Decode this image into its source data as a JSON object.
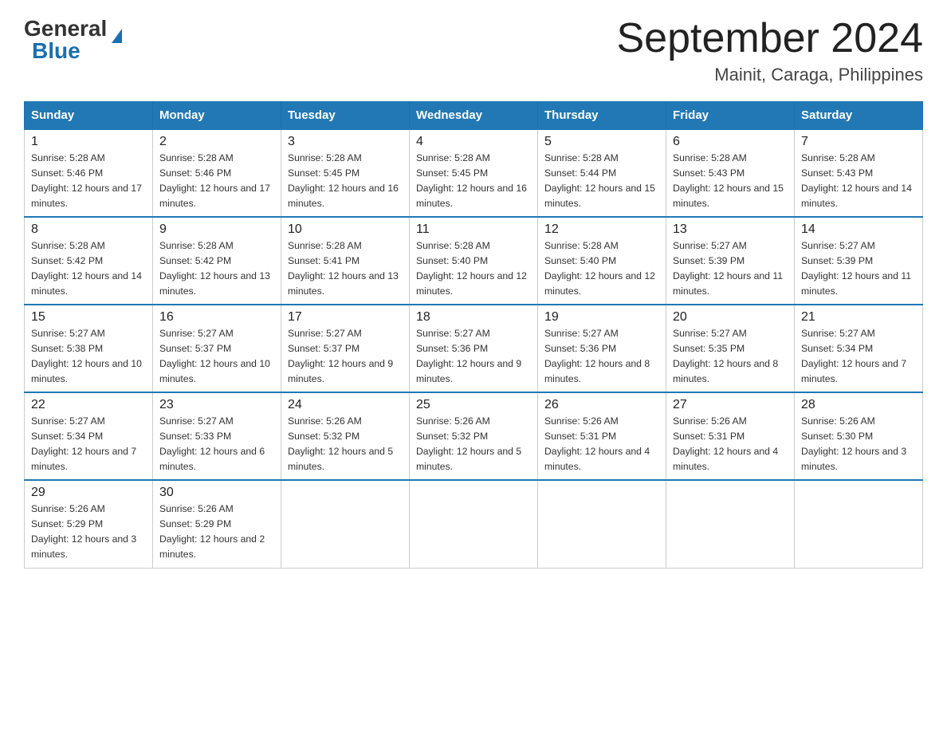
{
  "header": {
    "logo_general": "General",
    "logo_blue": "Blue",
    "month_year": "September 2024",
    "location": "Mainit, Caraga, Philippines"
  },
  "days_of_week": [
    "Sunday",
    "Monday",
    "Tuesday",
    "Wednesday",
    "Thursday",
    "Friday",
    "Saturday"
  ],
  "weeks": [
    [
      {
        "day": "1",
        "sunrise": "5:28 AM",
        "sunset": "5:46 PM",
        "daylight": "12 hours and 17 minutes."
      },
      {
        "day": "2",
        "sunrise": "5:28 AM",
        "sunset": "5:46 PM",
        "daylight": "12 hours and 17 minutes."
      },
      {
        "day": "3",
        "sunrise": "5:28 AM",
        "sunset": "5:45 PM",
        "daylight": "12 hours and 16 minutes."
      },
      {
        "day": "4",
        "sunrise": "5:28 AM",
        "sunset": "5:45 PM",
        "daylight": "12 hours and 16 minutes."
      },
      {
        "day": "5",
        "sunrise": "5:28 AM",
        "sunset": "5:44 PM",
        "daylight": "12 hours and 15 minutes."
      },
      {
        "day": "6",
        "sunrise": "5:28 AM",
        "sunset": "5:43 PM",
        "daylight": "12 hours and 15 minutes."
      },
      {
        "day": "7",
        "sunrise": "5:28 AM",
        "sunset": "5:43 PM",
        "daylight": "12 hours and 14 minutes."
      }
    ],
    [
      {
        "day": "8",
        "sunrise": "5:28 AM",
        "sunset": "5:42 PM",
        "daylight": "12 hours and 14 minutes."
      },
      {
        "day": "9",
        "sunrise": "5:28 AM",
        "sunset": "5:42 PM",
        "daylight": "12 hours and 13 minutes."
      },
      {
        "day": "10",
        "sunrise": "5:28 AM",
        "sunset": "5:41 PM",
        "daylight": "12 hours and 13 minutes."
      },
      {
        "day": "11",
        "sunrise": "5:28 AM",
        "sunset": "5:40 PM",
        "daylight": "12 hours and 12 minutes."
      },
      {
        "day": "12",
        "sunrise": "5:28 AM",
        "sunset": "5:40 PM",
        "daylight": "12 hours and 12 minutes."
      },
      {
        "day": "13",
        "sunrise": "5:27 AM",
        "sunset": "5:39 PM",
        "daylight": "12 hours and 11 minutes."
      },
      {
        "day": "14",
        "sunrise": "5:27 AM",
        "sunset": "5:39 PM",
        "daylight": "12 hours and 11 minutes."
      }
    ],
    [
      {
        "day": "15",
        "sunrise": "5:27 AM",
        "sunset": "5:38 PM",
        "daylight": "12 hours and 10 minutes."
      },
      {
        "day": "16",
        "sunrise": "5:27 AM",
        "sunset": "5:37 PM",
        "daylight": "12 hours and 10 minutes."
      },
      {
        "day": "17",
        "sunrise": "5:27 AM",
        "sunset": "5:37 PM",
        "daylight": "12 hours and 9 minutes."
      },
      {
        "day": "18",
        "sunrise": "5:27 AM",
        "sunset": "5:36 PM",
        "daylight": "12 hours and 9 minutes."
      },
      {
        "day": "19",
        "sunrise": "5:27 AM",
        "sunset": "5:36 PM",
        "daylight": "12 hours and 8 minutes."
      },
      {
        "day": "20",
        "sunrise": "5:27 AM",
        "sunset": "5:35 PM",
        "daylight": "12 hours and 8 minutes."
      },
      {
        "day": "21",
        "sunrise": "5:27 AM",
        "sunset": "5:34 PM",
        "daylight": "12 hours and 7 minutes."
      }
    ],
    [
      {
        "day": "22",
        "sunrise": "5:27 AM",
        "sunset": "5:34 PM",
        "daylight": "12 hours and 7 minutes."
      },
      {
        "day": "23",
        "sunrise": "5:27 AM",
        "sunset": "5:33 PM",
        "daylight": "12 hours and 6 minutes."
      },
      {
        "day": "24",
        "sunrise": "5:26 AM",
        "sunset": "5:32 PM",
        "daylight": "12 hours and 5 minutes."
      },
      {
        "day": "25",
        "sunrise": "5:26 AM",
        "sunset": "5:32 PM",
        "daylight": "12 hours and 5 minutes."
      },
      {
        "day": "26",
        "sunrise": "5:26 AM",
        "sunset": "5:31 PM",
        "daylight": "12 hours and 4 minutes."
      },
      {
        "day": "27",
        "sunrise": "5:26 AM",
        "sunset": "5:31 PM",
        "daylight": "12 hours and 4 minutes."
      },
      {
        "day": "28",
        "sunrise": "5:26 AM",
        "sunset": "5:30 PM",
        "daylight": "12 hours and 3 minutes."
      }
    ],
    [
      {
        "day": "29",
        "sunrise": "5:26 AM",
        "sunset": "5:29 PM",
        "daylight": "12 hours and 3 minutes."
      },
      {
        "day": "30",
        "sunrise": "5:26 AM",
        "sunset": "5:29 PM",
        "daylight": "12 hours and 2 minutes."
      },
      null,
      null,
      null,
      null,
      null
    ]
  ]
}
